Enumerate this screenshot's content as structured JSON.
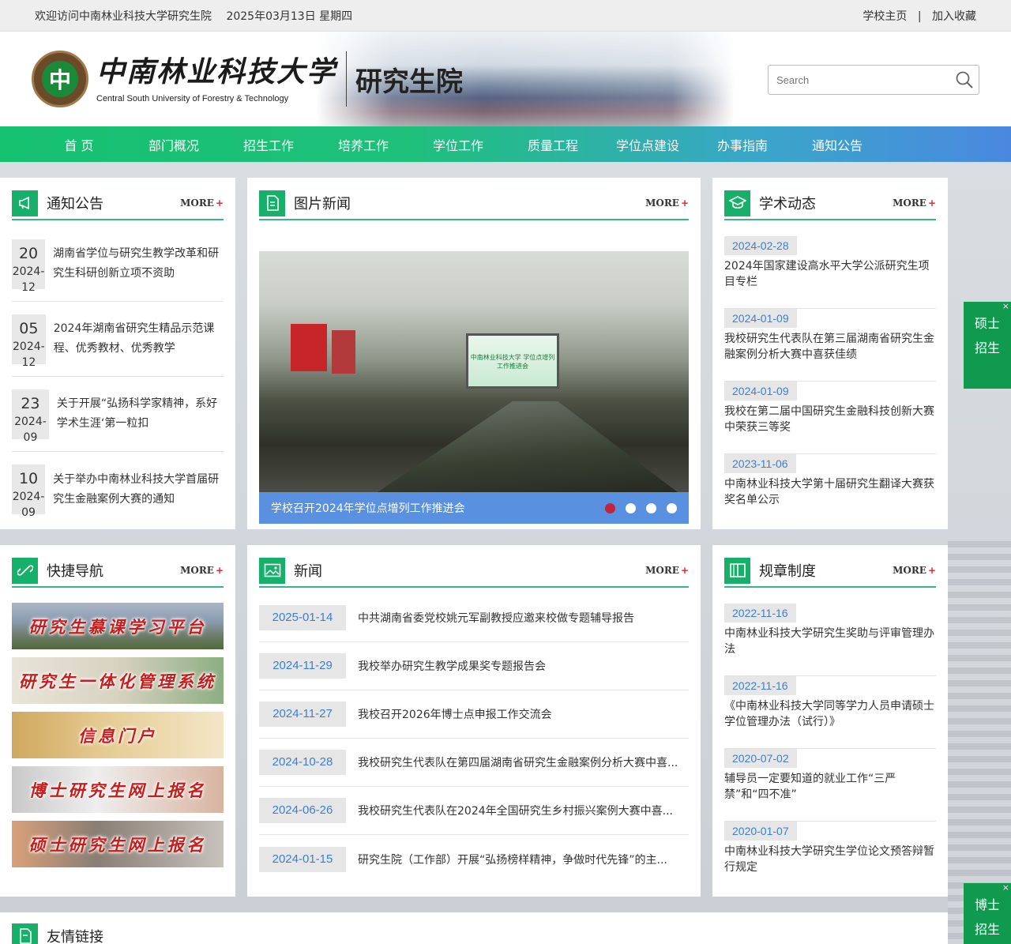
{
  "topbar": {
    "welcome": "欢迎访问中南林业科技大学研究生院",
    "date": "2025年03月13日 星期四",
    "links": [
      "学校主页",
      "加入收藏"
    ],
    "separator": "|"
  },
  "header": {
    "logo_cn": "中南林业科技大学",
    "logo_en": "Central South University of Forestry & Technology",
    "subtitle": "研究生院",
    "search_placeholder": "Search"
  },
  "nav": [
    "首 页",
    "部门概况",
    "招生工作",
    "培养工作",
    "学位工作",
    "质量工程",
    "学位点建设",
    "办事指南",
    "通知公告"
  ],
  "more_label": "MORE",
  "more_plus": "+",
  "notice": {
    "title": "通知公告",
    "items": [
      {
        "day": "20",
        "ym": "2024-12",
        "text": "湖南省学位与研究生教学改革和研究生科研创新立项不资助"
      },
      {
        "day": "05",
        "ym": "2024-12",
        "text": "2024年湖南省研究生精品示范课程、优秀教材、优秀教学"
      },
      {
        "day": "23",
        "ym": "2024-09",
        "text": "关于开展“弘扬科学家精神，系好学术生涯‘第一粒扣"
      },
      {
        "day": "10",
        "ym": "2024-09",
        "text": "关于举办中南林业科技大学首届研究生金融案例大赛的通知"
      }
    ]
  },
  "photo_news": {
    "title": "图片新闻",
    "caption": "学校召开2024年学位点增列工作推进会",
    "screen_text": "中南林业科技大学 学位点增列工作推进会",
    "dots": 4,
    "active_dot": 0
  },
  "academic": {
    "title": "学术动态",
    "items": [
      {
        "date": "2024-02-28",
        "text": "2024年国家建设高水平大学公派研究生项目专栏"
      },
      {
        "date": "2024-01-09",
        "text": "我校研究生代表队在第三届湖南省研究生金融案例分析大赛中喜获佳绩"
      },
      {
        "date": "2024-01-09",
        "text": "我校在第二届中国研究生金融科技创新大赛中荣获三等奖"
      },
      {
        "date": "2023-11-06",
        "text": "中南林业科技大学第十届研究生翻译大赛获奖名单公示"
      }
    ]
  },
  "quicknav": {
    "title": "快捷导航",
    "items": [
      "研究生慕课学习平台",
      "研究生一体化管理系统",
      "信息门户",
      "博士研究生网上报名",
      "硕士研究生网上报名"
    ]
  },
  "news": {
    "title": "新闻",
    "items": [
      {
        "date": "2025-01-14",
        "text": "中共湖南省委党校姚元军副教授应邀来校做专题辅导报告"
      },
      {
        "date": "2024-11-29",
        "text": "我校举办研究生教学成果奖专题报告会"
      },
      {
        "date": "2024-11-27",
        "text": "我校召开2026年博士点申报工作交流会"
      },
      {
        "date": "2024-10-28",
        "text": "我校研究生代表队在第四届湖南省研究生金融案例分析大赛中喜..."
      },
      {
        "date": "2024-06-26",
        "text": "我校研究生代表队在2024年全国研究生乡村振兴案例大赛中喜..."
      },
      {
        "date": "2024-01-15",
        "text": "研究生院（工作部）开展“弘扬榜样精神，争做时代先锋”的主..."
      }
    ]
  },
  "rules": {
    "title": "规章制度",
    "items": [
      {
        "date": "2022-11-16",
        "text": "中南林业科技大学研究生奖助与评审管理办法"
      },
      {
        "date": "2022-11-16",
        "text": "《中南林业科技大学同等学力人员申请硕士学位管理办法（试行）》"
      },
      {
        "date": "2020-07-02",
        "text": "辅导员一定要知道的就业工作“三严禁”和“四不准”"
      },
      {
        "date": "2020-01-07",
        "text": "中南林业科技大学研究生学位论文预答辩暂行规定"
      }
    ]
  },
  "links_section": {
    "title": "友情链接"
  },
  "float_master": [
    "硕士",
    "招生"
  ],
  "float_doctor": [
    "博士",
    "招生"
  ],
  "float_close": "×",
  "colors": {
    "accent_green": "#16b06a",
    "nav_blue": "#4a88e0",
    "date_blue": "#3c7fd0",
    "more_plus_red": "#e02020",
    "active_dot": "#c3233b"
  }
}
